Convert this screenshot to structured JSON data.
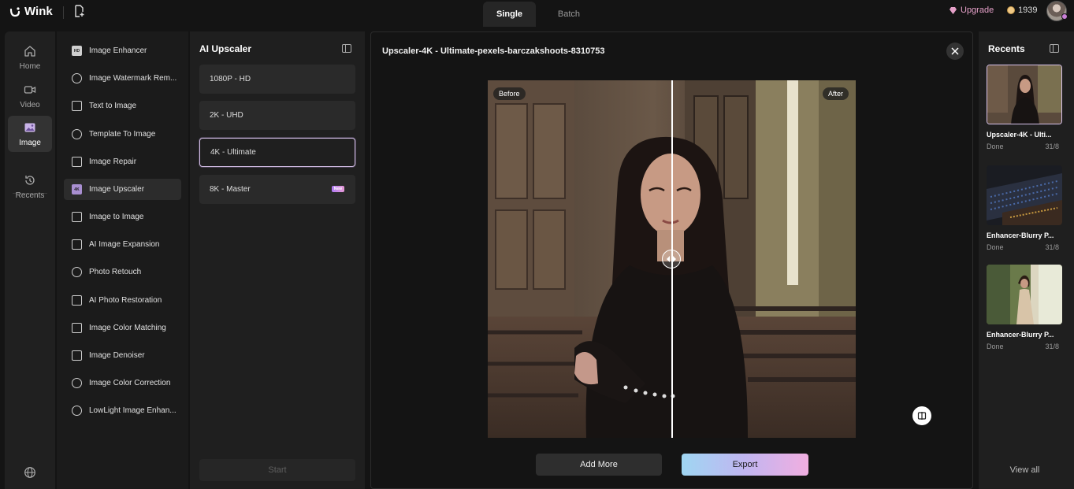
{
  "app": {
    "name": "Wink"
  },
  "header": {
    "mode_tabs": [
      {
        "label": "Single"
      },
      {
        "label": "Batch"
      }
    ],
    "upgrade_label": "Upgrade",
    "credits": "1939"
  },
  "leftnav": {
    "items": [
      {
        "label": "Home",
        "icon": "home-icon"
      },
      {
        "label": "Video",
        "icon": "video-icon"
      },
      {
        "label": "Image",
        "icon": "image-icon"
      },
      {
        "label": "Recents",
        "icon": "history-icon"
      }
    ]
  },
  "tools": [
    "Image Enhancer",
    "Image Watermark Rem...",
    "Text to Image",
    "Template To Image",
    "Image Repair",
    "Image Upscaler",
    "Image to Image",
    "AI Image Expansion",
    "Photo Retouch",
    "AI Photo Restoration",
    "Image Color Matching",
    "Image Denoiser",
    "Image Color Correction",
    "LowLight Image Enhan..."
  ],
  "upscaler": {
    "title": "AI Upscaler",
    "options": [
      {
        "label": "1080P - HD"
      },
      {
        "label": "2K - UHD"
      },
      {
        "label": "4K - Ultimate"
      },
      {
        "label": "8K - Master",
        "badge": "New"
      }
    ],
    "start_label": "Start"
  },
  "stage": {
    "title": "Upscaler-4K - Ultimate-pexels-barczakshoots-8310753",
    "before_label": "Before",
    "after_label": "After",
    "add_more_label": "Add More",
    "export_label": "Export"
  },
  "recents": {
    "title": "Recents",
    "items": [
      {
        "name": "Upscaler-4K - Ulti...",
        "status": "Done",
        "date": "31/8"
      },
      {
        "name": "Enhancer-Blurry P...",
        "status": "Done",
        "date": "31/8"
      },
      {
        "name": "Enhancer-Blurry P...",
        "status": "Done",
        "date": "31/8"
      }
    ],
    "view_all_label": "View all"
  },
  "colors": {
    "accent_pink": "#e5a0c8",
    "export_gradient": [
      "#9fd6f2",
      "#c1b6f1",
      "#f1aee0"
    ],
    "selected_border": "#d4bfe6"
  }
}
